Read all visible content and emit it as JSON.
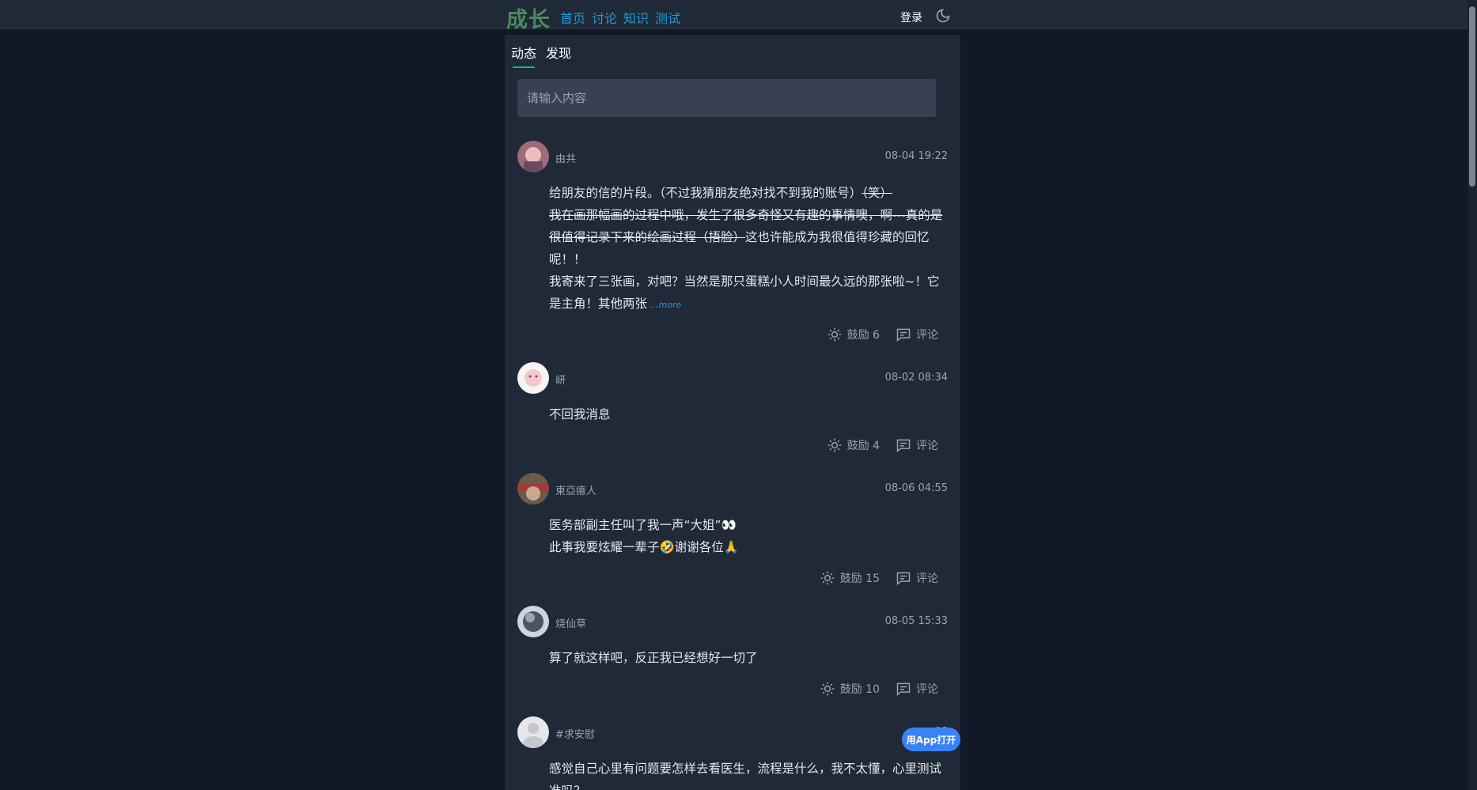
{
  "header": {
    "logo": "成长",
    "nav": [
      "首页",
      "讨论",
      "知识",
      "测试"
    ],
    "login": "登录"
  },
  "tabs": [
    "动态",
    "发现"
  ],
  "search": {
    "placeholder": "请输入内容"
  },
  "posts": [
    {
      "user": "由共",
      "time": "08-04 19:22",
      "lines": [
        "给朋友的信的片段。（不过我猜朋友绝对找不到我的账号）",
        "（笑）",
        "我在画那幅画的过程中哦，发生了很多奇怪又有趣的事情噢，啊---真的是很值得记录下来的绘画过程（捂脸）",
        "这也许能成为我很值得珍藏的回忆呢！！",
        "我寄来了三张画，对吧？当然是那只蛋糕小人时间最久远的那张啦~！它是主角！其他两张"
      ],
      "more": "...more",
      "cheer": "鼓励 6",
      "comment": "评论"
    },
    {
      "user": "岍",
      "time": "08-02 08:34",
      "lines": [
        "不回我消息"
      ],
      "cheer": "鼓励 4",
      "comment": "评论"
    },
    {
      "user": "東亞癔人",
      "time": "08-06 04:55",
      "lines": [
        "医务部副主任叫了我一声“大姐”👀",
        "此事我要炫耀一辈子🤣谢谢各位🙏"
      ],
      "cheer": "鼓励 15",
      "comment": "评论"
    },
    {
      "user": "烧仙草",
      "time": "08-05 15:33",
      "lines": [
        "算了就这样吧，反正我已经想好一切了"
      ],
      "cheer": "鼓励 10",
      "comment": "评论"
    },
    {
      "user": "#求安慰",
      "time": "08",
      "lines": [
        "感觉自己心里有问题要怎样去看医生，流程是什么，我不太懂，心里测试准吗？"
      ]
    }
  ],
  "app_button": "用App打开"
}
